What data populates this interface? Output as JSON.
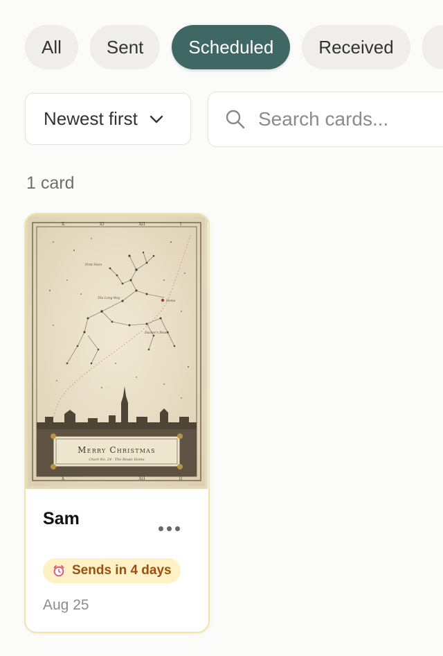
{
  "tabs": [
    {
      "label": "All",
      "active": false
    },
    {
      "label": "Sent",
      "active": false
    },
    {
      "label": "Scheduled",
      "active": true
    },
    {
      "label": "Received",
      "active": false
    }
  ],
  "sort": {
    "label": "Newest first",
    "icon": "chevron-down-icon"
  },
  "search": {
    "placeholder": "Search cards...",
    "value": "",
    "icon": "search-icon"
  },
  "result_count": "1 card",
  "cards": [
    {
      "recipient": "Sam",
      "status": "Sends in 4 days",
      "status_icon": "alarm-clock-icon",
      "date": "Aug 25",
      "artwork": {
        "title": "Merry Christmas",
        "subtitle": "Chart No. 24 · The Route Home",
        "labels": [
          "First Stars",
          "The Long Way",
          "Home",
          "Dasher's Reach"
        ],
        "roman_numerals": [
          "X",
          "XI",
          "XII",
          "I",
          "II"
        ]
      }
    }
  ],
  "colors": {
    "accent": "#3f6763",
    "chip_bg": "#efeeeb",
    "badge_bg": "#fdf1c5",
    "badge_text": "#9a4f10",
    "card_border": "#f2e3a6",
    "parchment": "#ede4cf"
  }
}
